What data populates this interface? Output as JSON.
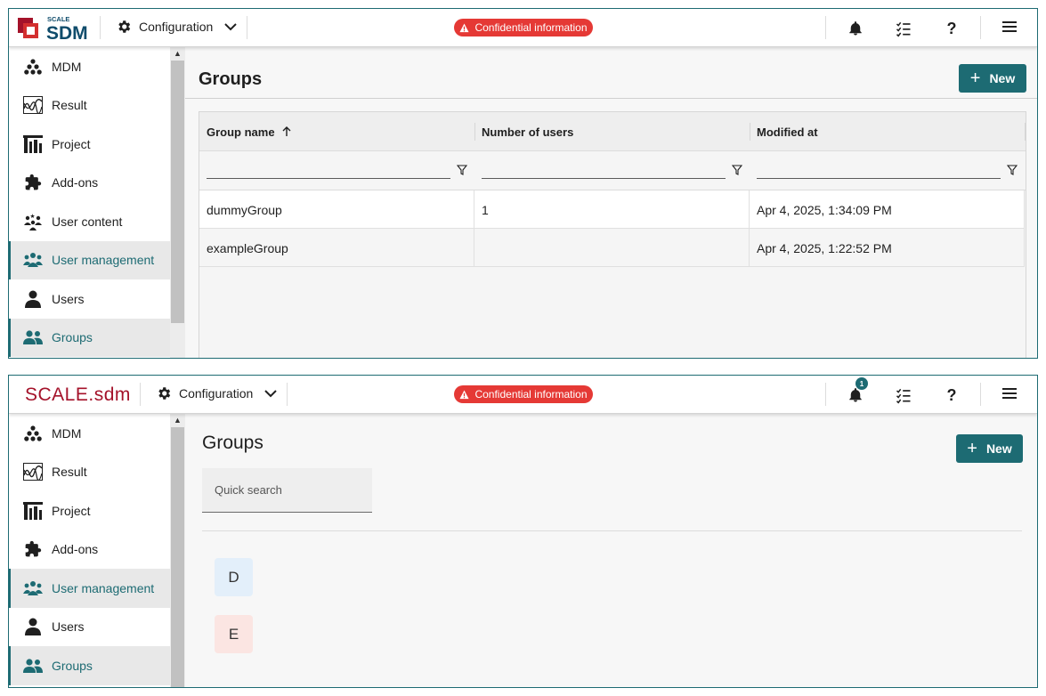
{
  "colors": {
    "accent": "#1d6b73",
    "brand": "#a4122a",
    "confidential": "#e53935",
    "tile_d": "#e3effa",
    "tile_e": "#fbe5e2"
  },
  "top": {
    "header": {
      "logo_small": "SCALE",
      "logo_big": "SDM",
      "config_label": "Configuration",
      "confidential_label": "Confidential information"
    },
    "sidebar": {
      "items": [
        {
          "label": "MDM",
          "icon": "mdm-icon"
        },
        {
          "label": "Result",
          "icon": "result-icon"
        },
        {
          "label": "Project",
          "icon": "project-icon"
        },
        {
          "label": "Add-ons",
          "icon": "puzzle-icon"
        },
        {
          "label": "User content",
          "icon": "user-content-icon"
        },
        {
          "label": "User management",
          "icon": "users-group-icon",
          "active": true
        },
        {
          "label": "Users",
          "icon": "person-icon"
        },
        {
          "label": "Groups",
          "icon": "users-group-icon",
          "selected": true
        }
      ]
    },
    "main": {
      "title": "Groups",
      "new_label": "New",
      "columns": [
        "Group name",
        "Number of users",
        "Modified at"
      ],
      "rows": [
        {
          "name": "dummyGroup",
          "users": "1",
          "modified": "Apr 4, 2025, 1:34:09 PM"
        },
        {
          "name": "exampleGroup",
          "users": "",
          "modified": "Apr 4, 2025, 1:22:52 PM"
        }
      ]
    }
  },
  "bottom": {
    "header": {
      "logo_text": "SCALE.sdm",
      "config_label": "Configuration",
      "confidential_label": "Confidential information",
      "notification_count": "1"
    },
    "sidebar": {
      "items": [
        {
          "label": "MDM",
          "icon": "mdm-icon"
        },
        {
          "label": "Result",
          "icon": "result-icon"
        },
        {
          "label": "Project",
          "icon": "project-icon"
        },
        {
          "label": "Add-ons",
          "icon": "puzzle-icon"
        },
        {
          "label": "User management",
          "icon": "users-group-icon",
          "active": true
        },
        {
          "label": "Users",
          "icon": "person-icon"
        },
        {
          "label": "Groups",
          "icon": "users-group-icon",
          "selected": true
        }
      ]
    },
    "main": {
      "title": "Groups",
      "new_label": "New",
      "search_placeholder": "Quick search",
      "tiles": [
        "D",
        "E"
      ]
    }
  }
}
